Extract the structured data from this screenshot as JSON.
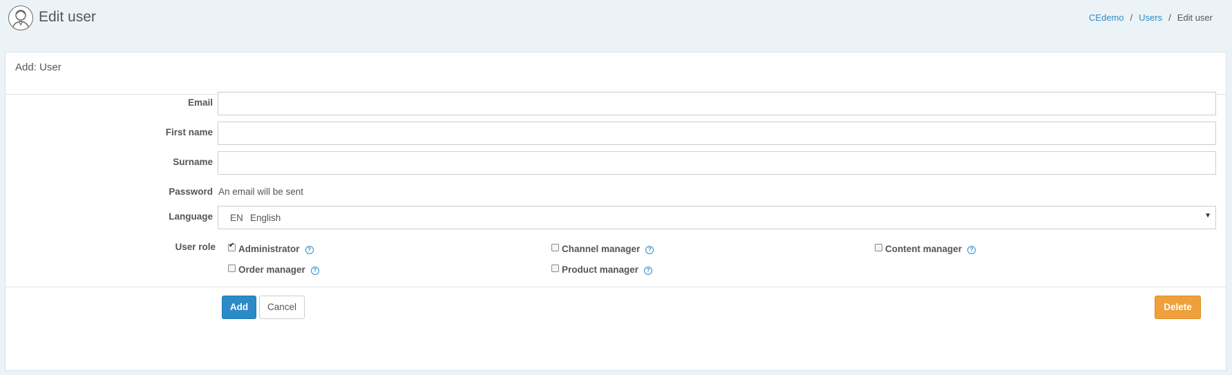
{
  "header": {
    "title": "Edit user",
    "breadcrumb": [
      {
        "label": "CEdemo"
      },
      {
        "label": "Users"
      },
      {
        "label": "Edit user"
      }
    ]
  },
  "card": {
    "title": "Add: User"
  },
  "form": {
    "email": {
      "label": "Email",
      "value": "",
      "placeholder": ""
    },
    "first_name": {
      "label": "First name",
      "value": "",
      "placeholder": ""
    },
    "surname": {
      "label": "Surname",
      "value": "",
      "placeholder": ""
    },
    "password": {
      "label": "Password",
      "text": "An email will be sent"
    },
    "language": {
      "label": "Language",
      "code": "EN",
      "name": "English"
    },
    "user_role": {
      "label": "User role",
      "roles": [
        {
          "label": "Administrator",
          "checked": true
        },
        {
          "label": "Channel manager",
          "checked": false
        },
        {
          "label": "Content manager",
          "checked": false
        },
        {
          "label": "Order manager",
          "checked": false
        },
        {
          "label": "Product manager",
          "checked": false
        }
      ]
    }
  },
  "actions": {
    "add": "Add",
    "cancel": "Cancel",
    "delete": "Delete"
  },
  "icons": {
    "avatar": "user-avatar-icon",
    "help": "question-circle-icon",
    "select_caret": "caret-down-icon"
  },
  "colors": {
    "primary": "#2b8bc8",
    "danger_orange": "#f0a03a",
    "page_bg": "#ecf3f6"
  }
}
